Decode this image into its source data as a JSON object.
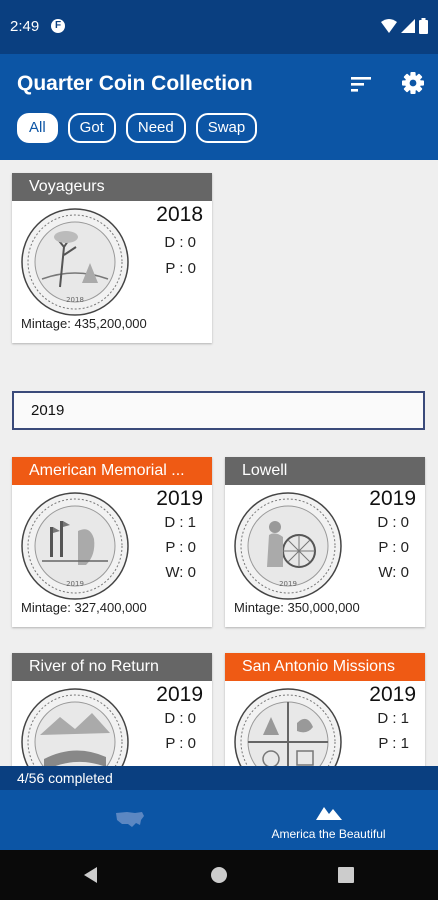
{
  "status_bar": {
    "time": "2:49",
    "notification_icon": "F"
  },
  "app_bar": {
    "title": "Quarter Coin Collection",
    "actions": [
      {
        "icon": "sort-icon"
      },
      {
        "icon": "gear-icon"
      }
    ],
    "filters": [
      {
        "label": "All",
        "selected": true
      },
      {
        "label": "Got",
        "selected": false
      },
      {
        "label": "Need",
        "selected": false
      },
      {
        "label": "Swap",
        "selected": false
      }
    ]
  },
  "coins": {
    "voyageurs": {
      "name": "Voyageurs",
      "year": "2018",
      "d": "D : 0",
      "p": "P : 0",
      "mintage": "Mintage: 435,200,000"
    },
    "year_field": {
      "value": "2019"
    },
    "american_memorial": {
      "name": "American Memorial ...",
      "year": "2019",
      "d": "D : 1",
      "p": "P : 0",
      "w": "W: 0",
      "mintage": "Mintage: 327,400,000"
    },
    "lowell": {
      "name": "Lowell",
      "year": "2019",
      "d": "D : 0",
      "p": "P : 0",
      "w": "W: 0",
      "mintage": "Mintage: 350,000,000"
    },
    "river_of_no_return": {
      "name": "River of no Return",
      "year": "2019",
      "d": "D : 0",
      "p": "P : 0"
    },
    "san_antonio_missions": {
      "name": "San Antonio Missions",
      "year": "2019",
      "d": "D : 1",
      "p": "P : 1"
    }
  },
  "progress": {
    "text": "4/56 completed"
  },
  "bottom_nav": [
    {
      "icon": "usa-map-icon",
      "label": ""
    },
    {
      "icon": "mountains-icon",
      "label": "America the Beautiful"
    }
  ],
  "colors": {
    "app_bar": "#0c55a5",
    "status_bar": "#0a3f80",
    "header_default": "#666666",
    "header_highlight": "#ef5a14"
  }
}
